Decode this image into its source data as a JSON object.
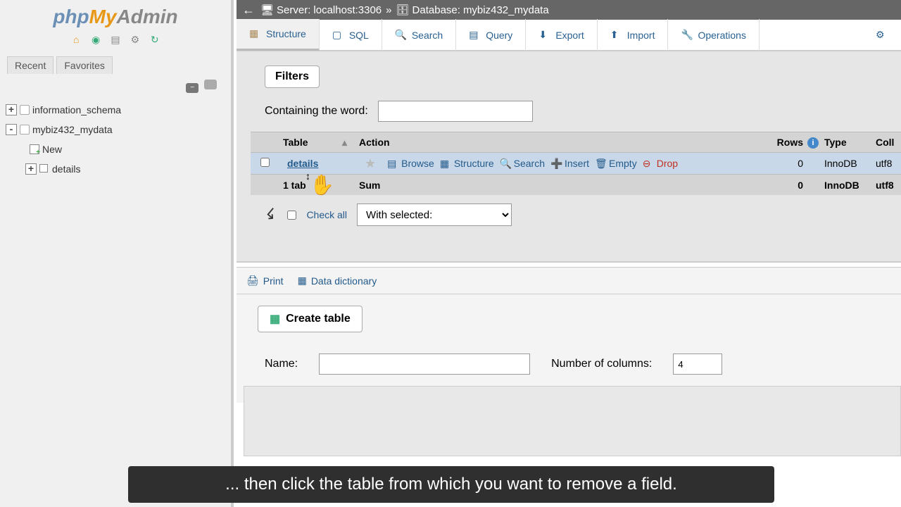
{
  "logo": {
    "php": "php",
    "my": "My",
    "admin": "Admin"
  },
  "sidebar": {
    "tabs": [
      "Recent",
      "Favorites"
    ],
    "tree": [
      {
        "name": "information_schema",
        "type": "db",
        "expand": "+"
      },
      {
        "name": "mybiz432_mydata",
        "type": "db",
        "expand": "-"
      },
      {
        "name": "New",
        "type": "new"
      },
      {
        "name": "details",
        "type": "table",
        "expand": "+"
      }
    ]
  },
  "breadcrumb": {
    "server_label": "Server:",
    "server": "localhost:3306",
    "db_label": "Database:",
    "db": "mybiz432_mydata",
    "sep": "»"
  },
  "main_tabs": [
    {
      "label": "Structure",
      "active": true
    },
    {
      "label": "SQL"
    },
    {
      "label": "Search"
    },
    {
      "label": "Query"
    },
    {
      "label": "Export"
    },
    {
      "label": "Import"
    },
    {
      "label": "Operations"
    }
  ],
  "filters": {
    "title": "Filters",
    "containing": "Containing the word:"
  },
  "table_header": {
    "table": "Table",
    "action": "Action",
    "rows": "Rows",
    "type": "Type",
    "coll": "Coll"
  },
  "tables": [
    {
      "name": "details",
      "rows": "0",
      "engine": "InnoDB",
      "coll": "utf8"
    }
  ],
  "actions": {
    "browse": "Browse",
    "structure": "Structure",
    "search": "Search",
    "insert": "Insert",
    "empty": "Empty",
    "drop": "Drop"
  },
  "summary": {
    "label": "1 tab",
    "sum": "Sum",
    "rows": "0",
    "engine": "InnoDB",
    "coll": "utf8"
  },
  "checkall": {
    "label": "Check all",
    "with_selected": "With selected:"
  },
  "below": {
    "print": "Print",
    "data_dict": "Data dictionary"
  },
  "create": {
    "btn": "Create table",
    "name_label": "Name:",
    "cols_label": "Number of columns:",
    "cols_value": "4"
  },
  "tooltip": "... then click the table from which you want to remove a field."
}
